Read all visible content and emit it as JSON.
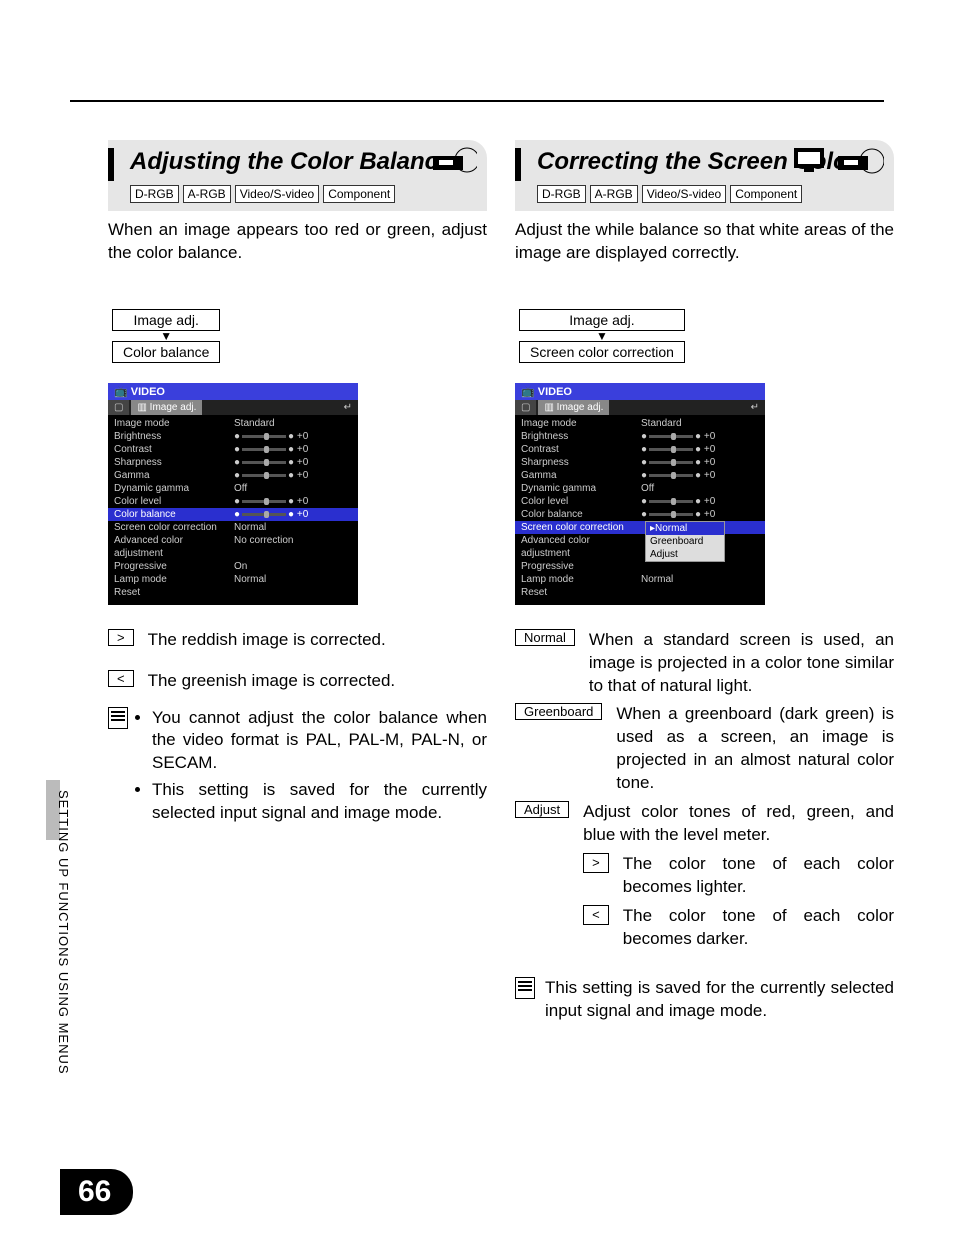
{
  "page_number": "66",
  "side_label": "SETTING UP FUNCTIONS USING MENUS",
  "left": {
    "title": "Adjusting the Color Balance",
    "badges": [
      "D-RGB",
      "A-RGB",
      "Video/S-video",
      "Component"
    ],
    "intro": "When an image appears too red or green, adjust the color balance.",
    "breadcrumb": {
      "top": "Image adj.",
      "bottom": "Color balance"
    },
    "menu": {
      "banner": "VIDEO",
      "tab": "Image adj.",
      "highlight": "Color balance",
      "rows": [
        {
          "label": "Image mode",
          "value": "Standard"
        },
        {
          "label": "Brightness",
          "value": "+0",
          "slider": true
        },
        {
          "label": "Contrast",
          "value": "+0",
          "slider": true
        },
        {
          "label": "Sharpness",
          "value": "+0",
          "slider": true
        },
        {
          "label": "Gamma",
          "value": "+0",
          "slider": true
        },
        {
          "label": "Dynamic gamma",
          "value": "Off"
        },
        {
          "label": "Color level",
          "value": "+0",
          "slider": true
        },
        {
          "label": "Color balance",
          "value": "+0",
          "slider": true
        },
        {
          "label": "Screen color correction",
          "value": "Normal"
        },
        {
          "label": "Advanced color adjustment",
          "value": "No correction"
        },
        {
          "label": "Progressive",
          "value": "On"
        },
        {
          "label": "Lamp mode",
          "value": "Normal"
        },
        {
          "label": "Reset",
          "value": ""
        }
      ]
    },
    "keys": [
      {
        "key": ">",
        "desc": "The reddish image is corrected."
      },
      {
        "key": "<",
        "desc": "The greenish image is corrected."
      }
    ],
    "notes": [
      "You cannot adjust the color balance when the video format is PAL, PAL-M, PAL-N, or SECAM.",
      "This setting is saved for the currently selected input signal and image mode."
    ]
  },
  "right": {
    "title": "Correcting the Screen Color",
    "badges": [
      "D-RGB",
      "A-RGB",
      "Video/S-video",
      "Component"
    ],
    "intro": "Adjust the while balance so that white areas of the image are displayed correctly.",
    "breadcrumb": {
      "top": "Image adj.",
      "bottom": "Screen color correction"
    },
    "menu": {
      "banner": "VIDEO",
      "tab": "Image adj.",
      "highlight": "Screen color correction",
      "rows": [
        {
          "label": "Image mode",
          "value": "Standard"
        },
        {
          "label": "Brightness",
          "value": "+0",
          "slider": true
        },
        {
          "label": "Contrast",
          "value": "+0",
          "slider": true
        },
        {
          "label": "Sharpness",
          "value": "+0",
          "slider": true
        },
        {
          "label": "Gamma",
          "value": "+0",
          "slider": true
        },
        {
          "label": "Dynamic gamma",
          "value": "Off"
        },
        {
          "label": "Color level",
          "value": "+0",
          "slider": true
        },
        {
          "label": "Color balance",
          "value": "+0",
          "slider": true
        },
        {
          "label": "Screen color correction",
          "value": ""
        },
        {
          "label": "Advanced color adjustment",
          "value": ""
        },
        {
          "label": "Progressive",
          "value": ""
        },
        {
          "label": "Lamp mode",
          "value": "Normal"
        },
        {
          "label": "Reset",
          "value": ""
        }
      ],
      "dropdown": {
        "options": [
          "Normal",
          "Greenboard",
          "Adjust"
        ],
        "selected": "Normal"
      }
    },
    "options": [
      {
        "key": "Normal",
        "desc": "When a standard screen is used, an image is projected in a color tone similar to that of natural light."
      },
      {
        "key": "Greenboard",
        "desc": "When a greenboard (dark green) is used as a screen, an image is projected in an almost natural color tone."
      },
      {
        "key": "Adjust",
        "desc": "Adjust color tones of red, green, and blue with the level meter.",
        "sub": [
          {
            "key": ">",
            "desc": "The color tone of each color becomes lighter."
          },
          {
            "key": "<",
            "desc": "The color tone of each color becomes darker."
          }
        ]
      }
    ],
    "note": "This setting is saved for the currently selected input signal and image mode."
  }
}
